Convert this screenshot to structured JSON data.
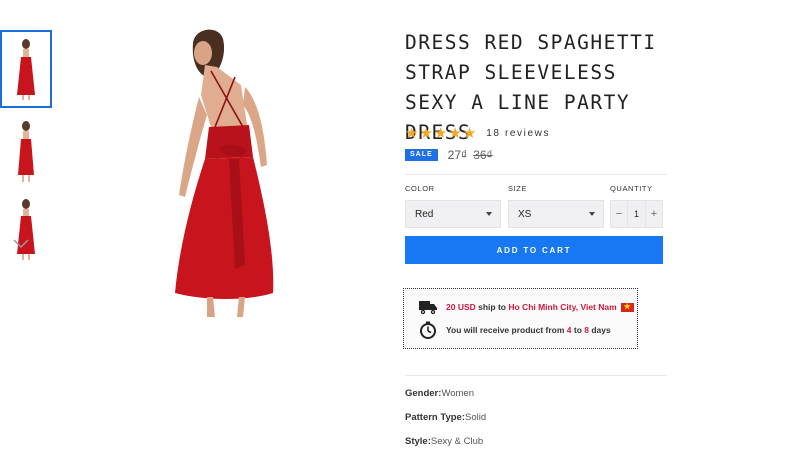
{
  "product": {
    "title": "DRESS RED SPAGHETTI STRAP SLEEVELESS SEXY A LINE PARTY DRESS",
    "rating": 5,
    "reviews_text": "18 reviews",
    "sale_badge": "SALE",
    "price": "27₫",
    "compare_price": "36₫"
  },
  "thumbnails": [
    "dress-back-view",
    "dress-side-view",
    "dress-front-view"
  ],
  "options": {
    "color_label": "COLOR",
    "color_value": "Red",
    "size_label": "SIZE",
    "size_value": "XS",
    "quantity_label": "QUANTITY",
    "quantity_value": "1",
    "minus": "−",
    "plus": "+"
  },
  "add_to_cart": "ADD TO CART",
  "shipping": {
    "price": "20 USD",
    "ship_to": " ship to ",
    "destination": "Ho Chi Minh City, Viet Nam",
    "receive_prefix": "You will receive product from ",
    "min_days": "4",
    "to": " to ",
    "max_days": "8",
    "days": " days"
  },
  "specs": [
    {
      "label": "Gender:",
      "value": "Women"
    },
    {
      "label": "Pattern Type:",
      "value": "Solid"
    },
    {
      "label": "Style:",
      "value": "Sexy & Club"
    }
  ],
  "colors": {
    "accent": "#1877f2",
    "dress": "#c8141c",
    "star": "#f5a623",
    "highlight": "#d1173f"
  }
}
